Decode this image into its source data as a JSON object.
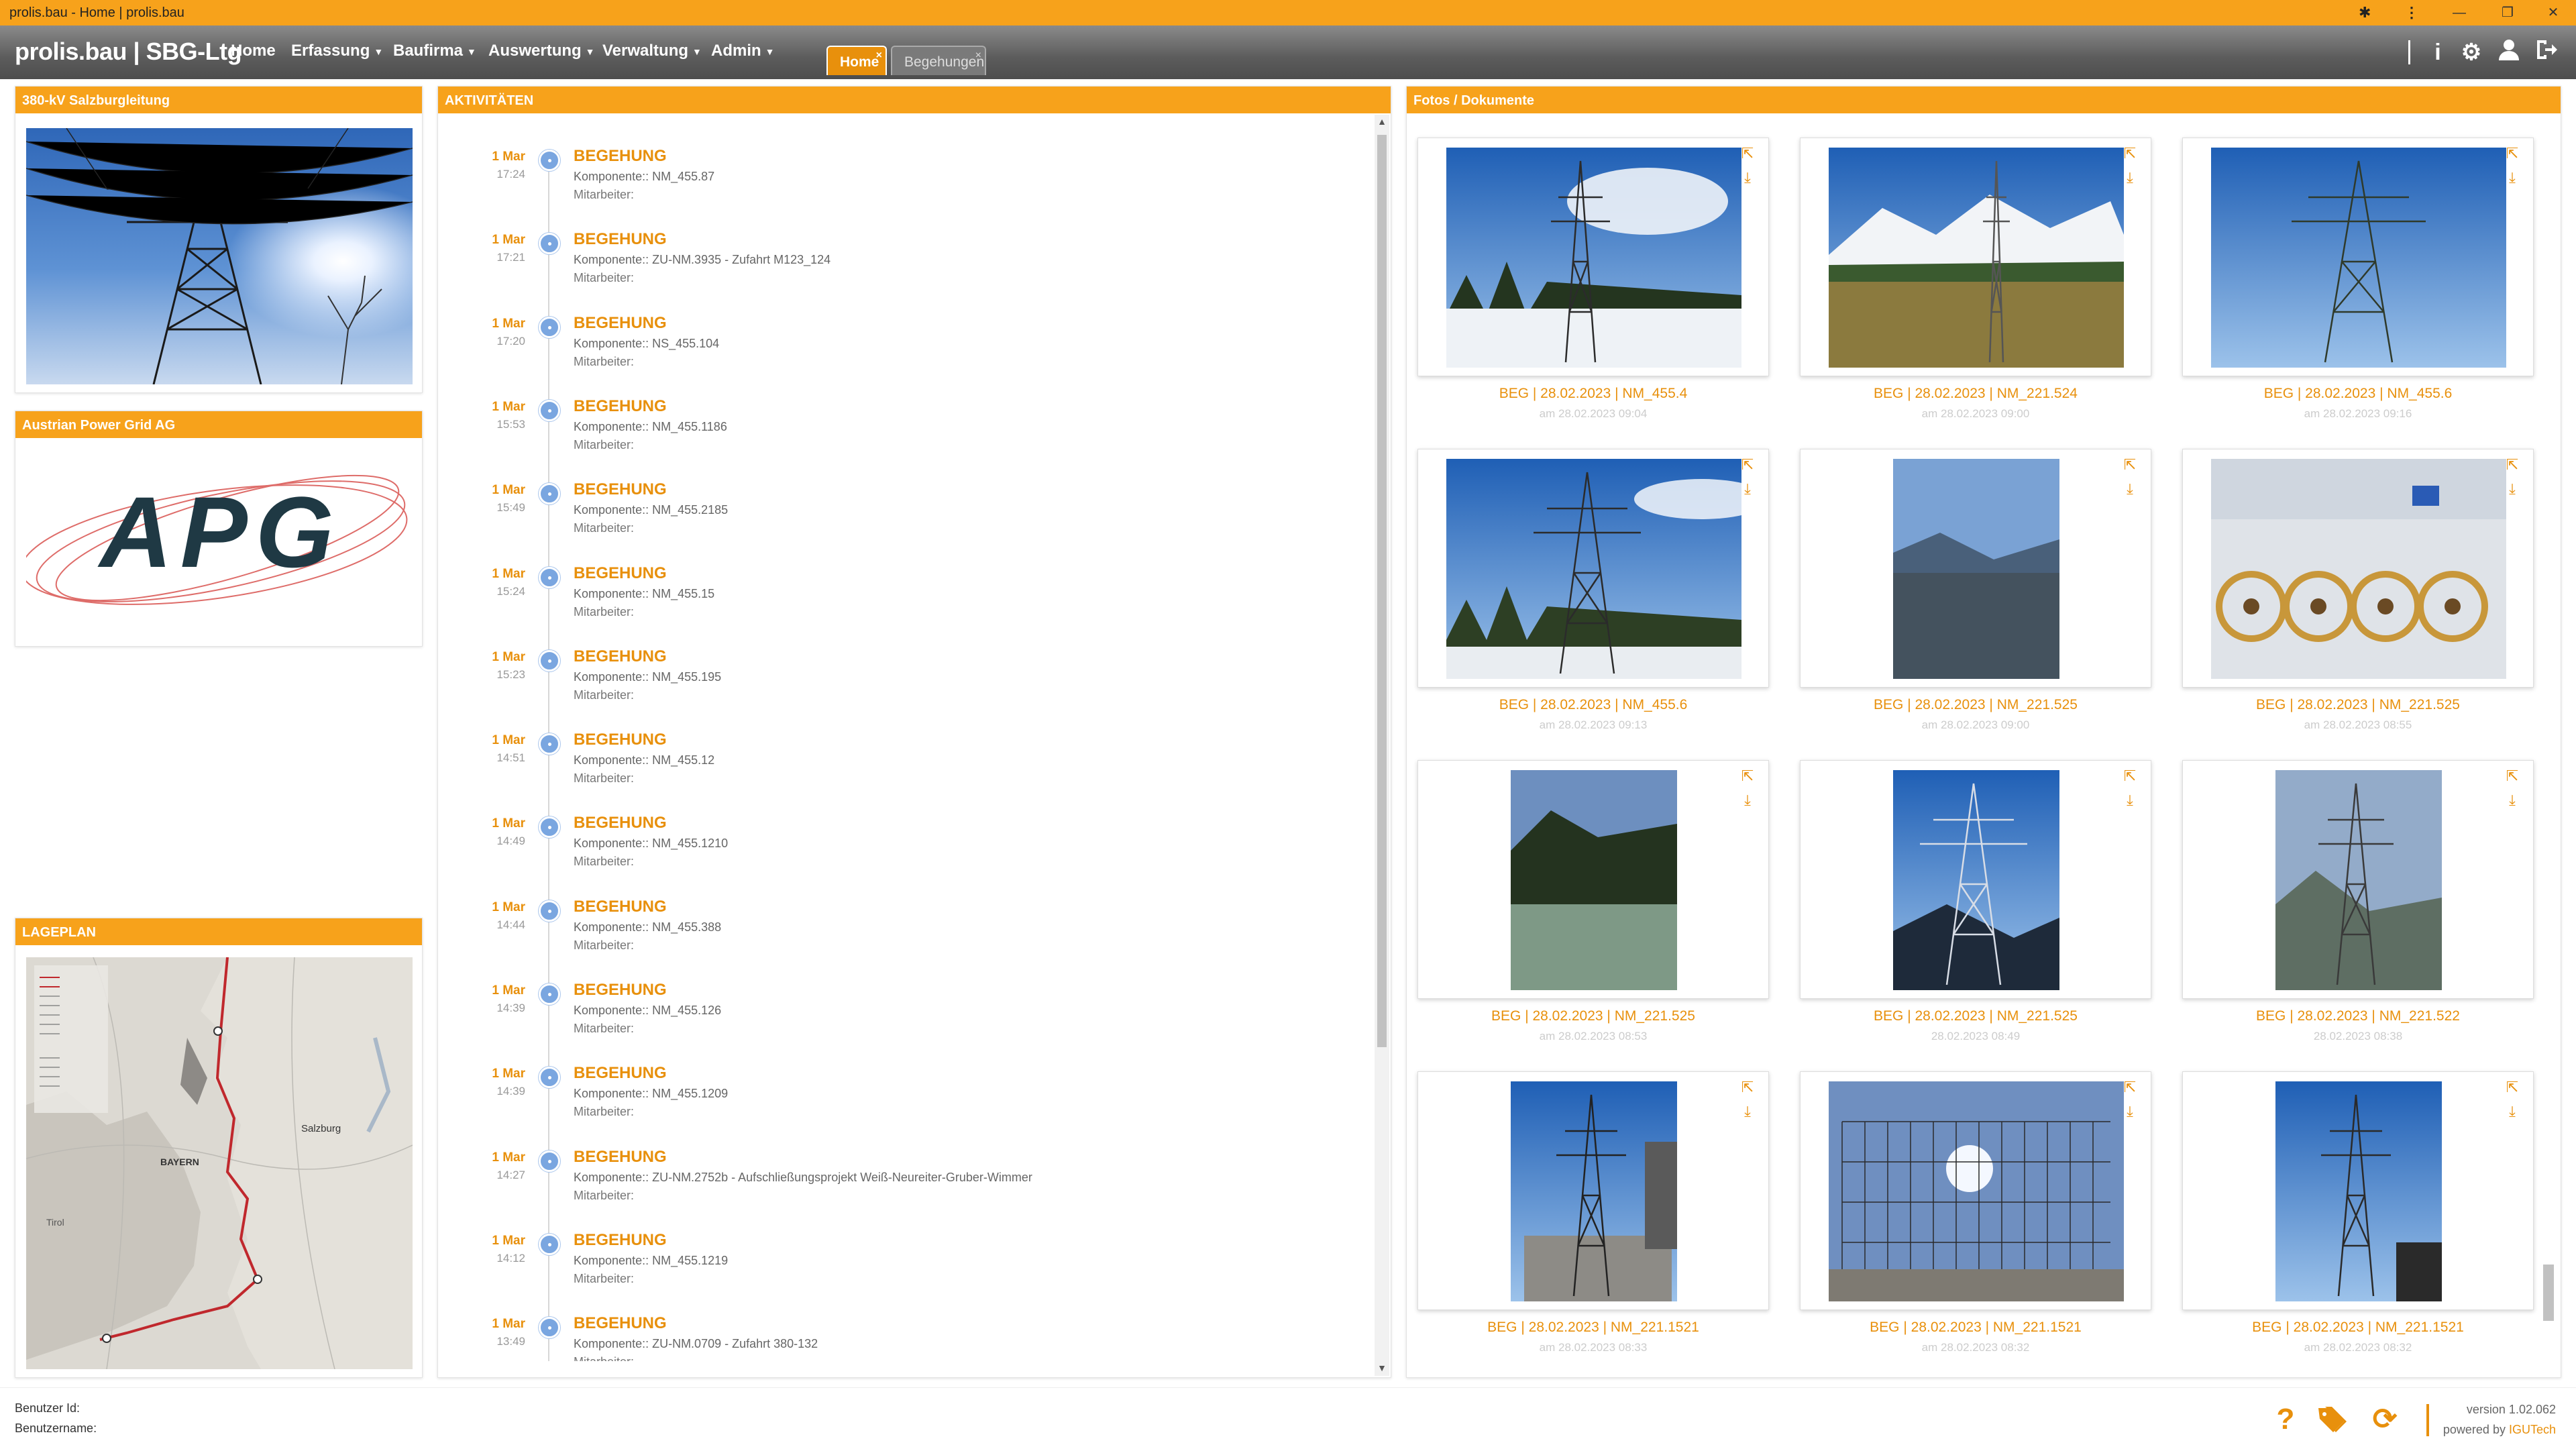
{
  "window": {
    "title": "prolis.bau - Home | prolis.bau",
    "controls": [
      "—",
      "❐",
      "✕"
    ]
  },
  "brand": "prolis.bau | SBG-Ltg",
  "menu": [
    {
      "label": "Home"
    },
    {
      "label": "Erfassung"
    },
    {
      "label": "Baufirma"
    },
    {
      "label": "Auswertung"
    },
    {
      "label": "Verwaltung"
    },
    {
      "label": "Admin"
    }
  ],
  "tabs": [
    {
      "label": "Home",
      "active": true
    },
    {
      "label": "Begehungen",
      "active": false
    }
  ],
  "nav_icons": [
    "info-icon",
    "gear-icon",
    "user-icon",
    "logout-icon"
  ],
  "left": {
    "project": {
      "title": "380-kV Salzburgleitung"
    },
    "company": {
      "title": "Austrian Power Grid AG",
      "logo_text": "APG"
    },
    "map": {
      "title": "LAGEPLAN",
      "labels": [
        "BAYERN",
        "Salzburg",
        "Tirol"
      ]
    }
  },
  "activities": {
    "title": "AKTIVITÄTEN",
    "items": [
      {
        "date": "1 Mar",
        "time": "17:24",
        "type": "BEGEHUNG",
        "komponente": "Komponente:: NM_455.87",
        "mitarbeiter": "Mitarbeiter:"
      },
      {
        "date": "1 Mar",
        "time": "17:21",
        "type": "BEGEHUNG",
        "komponente": "Komponente:: ZU-NM.3935 - Zufahrt M123_124",
        "mitarbeiter": "Mitarbeiter:"
      },
      {
        "date": "1 Mar",
        "time": "17:20",
        "type": "BEGEHUNG",
        "komponente": "Komponente:: NS_455.104",
        "mitarbeiter": "Mitarbeiter:"
      },
      {
        "date": "1 Mar",
        "time": "15:53",
        "type": "BEGEHUNG",
        "komponente": "Komponente:: NM_455.1186",
        "mitarbeiter": "Mitarbeiter:"
      },
      {
        "date": "1 Mar",
        "time": "15:49",
        "type": "BEGEHUNG",
        "komponente": "Komponente:: NM_455.2185",
        "mitarbeiter": "Mitarbeiter:"
      },
      {
        "date": "1 Mar",
        "time": "15:24",
        "type": "BEGEHUNG",
        "komponente": "Komponente:: NM_455.15",
        "mitarbeiter": "Mitarbeiter:"
      },
      {
        "date": "1 Mar",
        "time": "15:23",
        "type": "BEGEHUNG",
        "komponente": "Komponente:: NM_455.195",
        "mitarbeiter": "Mitarbeiter:"
      },
      {
        "date": "1 Mar",
        "time": "14:51",
        "type": "BEGEHUNG",
        "komponente": "Komponente:: NM_455.12",
        "mitarbeiter": "Mitarbeiter:"
      },
      {
        "date": "1 Mar",
        "time": "14:49",
        "type": "BEGEHUNG",
        "komponente": "Komponente:: NM_455.1210",
        "mitarbeiter": "Mitarbeiter:"
      },
      {
        "date": "1 Mar",
        "time": "14:44",
        "type": "BEGEHUNG",
        "komponente": "Komponente:: NM_455.388",
        "mitarbeiter": "Mitarbeiter:"
      },
      {
        "date": "1 Mar",
        "time": "14:39",
        "type": "BEGEHUNG",
        "komponente": "Komponente:: NM_455.126",
        "mitarbeiter": "Mitarbeiter:"
      },
      {
        "date": "1 Mar",
        "time": "14:39",
        "type": "BEGEHUNG",
        "komponente": "Komponente:: NM_455.1209",
        "mitarbeiter": "Mitarbeiter:"
      },
      {
        "date": "1 Mar",
        "time": "14:27",
        "type": "BEGEHUNG",
        "komponente": "Komponente:: ZU-NM.2752b - Aufschließungsprojekt Weiß-Neureiter-Gruber-Wimmer",
        "mitarbeiter": "Mitarbeiter:"
      },
      {
        "date": "1 Mar",
        "time": "14:12",
        "type": "BEGEHUNG",
        "komponente": "Komponente:: NM_455.1219",
        "mitarbeiter": "Mitarbeiter:"
      },
      {
        "date": "1 Mar",
        "time": "13:49",
        "type": "BEGEHUNG",
        "komponente": "Komponente:: ZU-NM.0709 - Zufahrt 380-132",
        "mitarbeiter": "Mitarbeiter:"
      }
    ]
  },
  "photos": {
    "title": "Fotos / Dokumente",
    "items": [
      {
        "caption": "BEG | 28.02.2023 | NM_455.4",
        "sub": "am 28.02.2023 09:04",
        "scene": "snow"
      },
      {
        "caption": "BEG | 28.02.2023 | NM_221.524",
        "sub": "am 28.02.2023 09:00",
        "scene": "field"
      },
      {
        "caption": "BEG | 28.02.2023 | NM_455.6",
        "sub": "am 28.02.2023 09:16",
        "scene": "tower"
      },
      {
        "caption": "BEG | 28.02.2023 | NM_455.6",
        "sub": "am 28.02.2023 09:13",
        "scene": "snow2"
      },
      {
        "caption": "BEG | 28.02.2023 | NM_221.525",
        "sub": "am 28.02.2023 09:00",
        "scene": "valley"
      },
      {
        "caption": "BEG | 28.02.2023 | NM_221.525",
        "sub": "am 28.02.2023 08:55",
        "scene": "reels"
      },
      {
        "caption": "BEG | 28.02.2023 | NM_221.525",
        "sub": "am 28.02.2023 08:53",
        "scene": "site"
      },
      {
        "caption": "BEG | 28.02.2023 | NM_221.525",
        "sub": "28.02.2023 08:49",
        "scene": "tower2"
      },
      {
        "caption": "BEG | 28.02.2023 | NM_221.522",
        "sub": "28.02.2023 08:38",
        "scene": "tower3"
      },
      {
        "caption": "BEG | 28.02.2023 | NM_221.1521",
        "sub": "am 28.02.2023 08:33",
        "scene": "construct"
      },
      {
        "caption": "BEG | 28.02.2023 | NM_221.1521",
        "sub": "am 28.02.2023 08:32",
        "scene": "scaffold"
      },
      {
        "caption": "BEG | 28.02.2023 | NM_221.1521",
        "sub": "am 28.02.2023 08:32",
        "scene": "tower4"
      }
    ]
  },
  "footer": {
    "user_id_label": "Benutzer Id:",
    "user_name_label": "Benutzername:",
    "version": "version 1.02.062",
    "powered_prefix": "powered by",
    "powered_brand": "IGUTech",
    "icons": [
      "help-icon",
      "tags-icon",
      "refresh-icon"
    ]
  }
}
